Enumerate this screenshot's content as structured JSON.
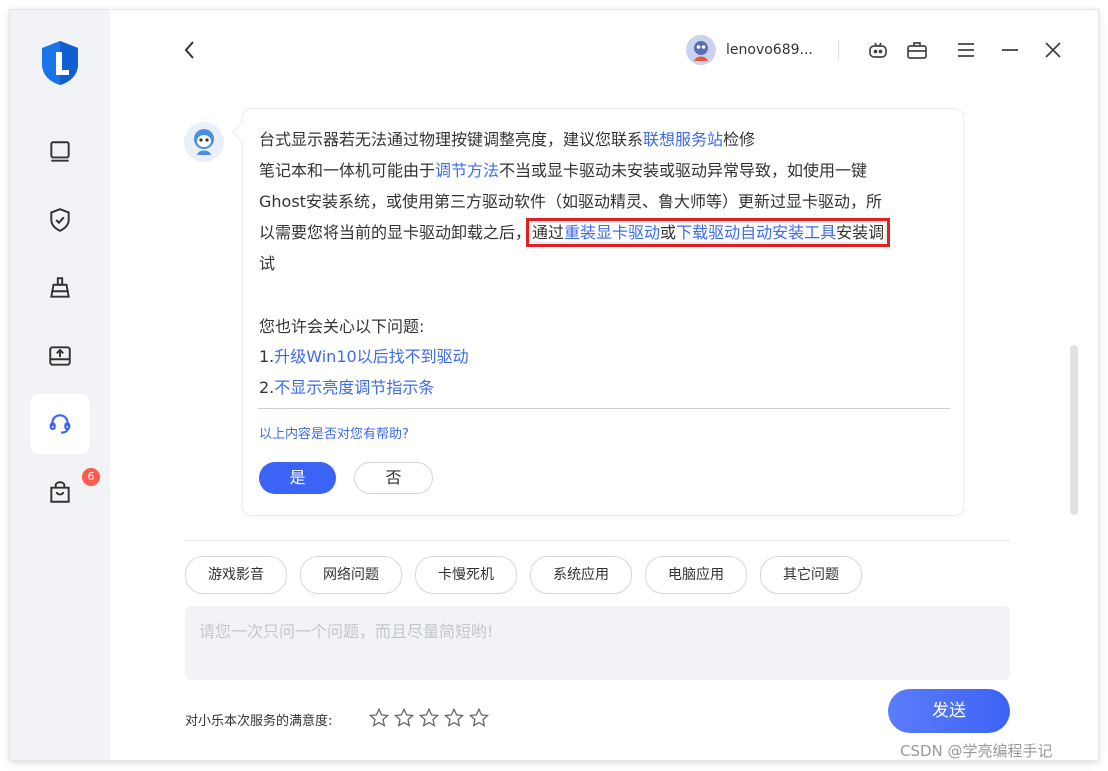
{
  "header": {
    "username": "lenovo689..."
  },
  "sidebar": {
    "badge_count": "6"
  },
  "chat": {
    "line1": {
      "pre": "台式显示器若无法通过物理按键调整亮度，建议您联系",
      "link": "联想服务站",
      "post": "检修"
    },
    "line2": {
      "pre": "笔记本和一体机可能由于",
      "link": "调节方法",
      "post": "不当或显卡驱动未安装或驱动异常导致，如使用一键"
    },
    "line3": "Ghost安装系统，或使用第三方驱动软件（如驱动精灵、鲁大师等）更新过显卡驱动，所",
    "line4": {
      "pre": "以需要您将当前的显卡驱动卸载之后，",
      "hl_pre": "通过",
      "link1": "重装显卡驱动",
      "mid": "或",
      "link2": "下载驱动自动安装工具",
      "post": "安装调"
    },
    "line5": "试",
    "related_title": "您也许会关心以下问题:",
    "related": [
      {
        "num": "1.",
        "text": "升级Win10以后找不到驱动"
      },
      {
        "num": "2.",
        "text": "不显示亮度调节指示条"
      }
    ],
    "helpful_question": "以上内容是否对您有帮助?",
    "yes_label": "是",
    "no_label": "否"
  },
  "categories": [
    "游戏影音",
    "网络问题",
    "卡慢死机",
    "系统应用",
    "电脑应用",
    "其它问题"
  ],
  "input": {
    "placeholder": "请您一次只问一个问题，而且尽量简短哟!"
  },
  "footer": {
    "satisfaction_label": "对小乐本次服务的满意度:",
    "send_label": "发送"
  },
  "watermark": "CSDN @学亮编程手记",
  "colors": {
    "accent": "#3b63f5",
    "link": "#3d6bf0",
    "badge": "#ff5a4e",
    "highlight_border": "#e02020"
  },
  "icons": [
    "logo-icon",
    "computer-icon",
    "shield-icon",
    "broom-icon",
    "drive-icon",
    "headset-icon",
    "bag-icon",
    "back-arrow-icon",
    "robot-icon",
    "toolbox-icon",
    "menu-icon",
    "minimize-icon",
    "close-icon",
    "star-icon"
  ]
}
